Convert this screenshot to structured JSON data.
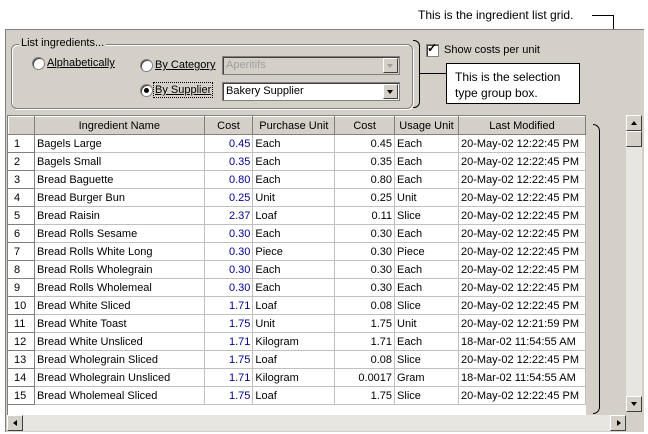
{
  "callouts": {
    "grid": "This is the ingredient list grid.",
    "groupbox_line1": "This is the selection",
    "groupbox_line2": "type group box."
  },
  "group": {
    "legend": "List ingredients...",
    "alphabetically": "Alphabetically",
    "by_category": "By Category",
    "by_supplier": "By Supplier",
    "selected": "By Supplier",
    "category_value": "Aperitifs",
    "supplier_value": "Bakery Supplier"
  },
  "options": {
    "show_costs_label": "Show costs per unit",
    "show_costs_checked": true,
    "check_mark": "✓"
  },
  "grid": {
    "columns": [
      "",
      "Ingredient Name",
      "Cost",
      "Purchase Unit",
      "Cost",
      "Usage Unit",
      "Last Modified"
    ],
    "rows": [
      [
        "1",
        "Bagels Large",
        "0.45",
        "Each",
        "0.45",
        "Each",
        "20-May-02 12:22:45 PM"
      ],
      [
        "2",
        "Bagels Small",
        "0.35",
        "Each",
        "0.35",
        "Each",
        "20-May-02 12:22:45 PM"
      ],
      [
        "3",
        "Bread Baguette",
        "0.80",
        "Each",
        "0.80",
        "Each",
        "20-May-02 12:22:45 PM"
      ],
      [
        "4",
        "Bread Burger Bun",
        "0.25",
        "Unit",
        "0.25",
        "Unit",
        "20-May-02 12:22:45 PM"
      ],
      [
        "5",
        "Bread Raisin",
        "2.37",
        "Loaf",
        "0.11",
        "Slice",
        "20-May-02 12:22:45 PM"
      ],
      [
        "6",
        "Bread Rolls Sesame",
        "0.30",
        "Each",
        "0.30",
        "Each",
        "20-May-02 12:22:45 PM"
      ],
      [
        "7",
        "Bread Rolls White Long",
        "0.30",
        "Piece",
        "0.30",
        "Piece",
        "20-May-02 12:22:45 PM"
      ],
      [
        "8",
        "Bread Rolls Wholegrain",
        "0.30",
        "Each",
        "0.30",
        "Each",
        "20-May-02 12:22:45 PM"
      ],
      [
        "9",
        "Bread Rolls Wholemeal",
        "0.30",
        "Each",
        "0.30",
        "Each",
        "20-May-02 12:22:45 PM"
      ],
      [
        "10",
        "Bread White Sliced",
        "1.71",
        "Loaf",
        "0.08",
        "Slice",
        "20-May-02 12:22:45 PM"
      ],
      [
        "11",
        "Bread White Toast",
        "1.75",
        "Unit",
        "1.75",
        "Unit",
        "20-May-02 12:21:59 PM"
      ],
      [
        "12",
        "Bread White Unsliced",
        "1.71",
        "Kilogram",
        "1.71",
        "Each",
        "18-Mar-02 11:54:55 AM"
      ],
      [
        "13",
        "Bread Wholegrain Sliced",
        "1.75",
        "Loaf",
        "0.08",
        "Slice",
        "20-May-02 12:22:45 PM"
      ],
      [
        "14",
        "Bread Wholegrain Unsliced",
        "1.71",
        "Kilogram",
        "0.0017",
        "Gram",
        "18-Mar-02 11:54:55 AM"
      ],
      [
        "15",
        "Bread Wholemeal Sliced",
        "1.75",
        "Loaf",
        "1.75",
        "Slice",
        "20-May-02 12:22:45 PM"
      ]
    ]
  },
  "colors": {
    "panel": "#d4d0c8",
    "cost_text": "#00008b"
  }
}
